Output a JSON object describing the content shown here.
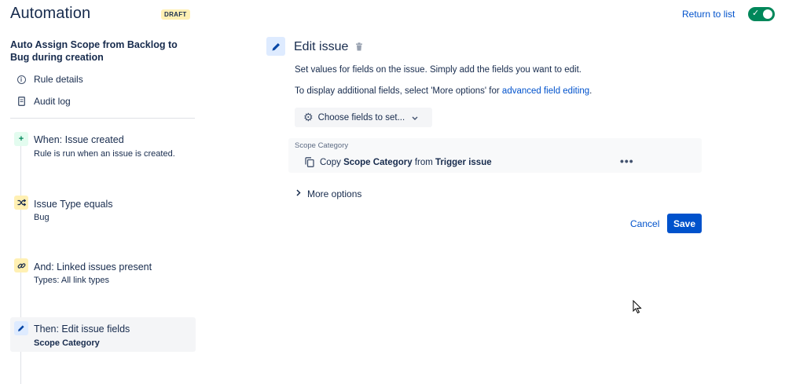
{
  "header": {
    "title": "Automation",
    "badge": "DRAFT",
    "return_link": "Return to list",
    "toggle_state": "enabled",
    "accent_color": "#00875a"
  },
  "sidebar": {
    "rule_name": "Auto Assign Scope from Backlog to Bug during creation",
    "meta": [
      {
        "label": "Rule details",
        "icon": "info-icon"
      },
      {
        "label": "Audit log",
        "icon": "document-icon"
      }
    ],
    "steps": [
      {
        "title": "When: Issue created",
        "subtitle": "Rule is run when an issue is created.",
        "icon": "plus-icon"
      },
      {
        "title": "Issue Type equals",
        "subtitle": "Bug",
        "icon": "shuffle-icon"
      },
      {
        "title": "And: Linked issues present",
        "subtitle": "Types: All link types",
        "icon": "link-icon"
      },
      {
        "title": "Then: Edit issue fields",
        "subtitle": "Scope Category",
        "icon": "pencil-icon",
        "selected": true
      }
    ]
  },
  "main": {
    "title": "Edit issue",
    "description_1": "Set values for fields on the issue. Simply add the fields you want to edit.",
    "description_2_prefix": "To display additional fields, select 'More options' for ",
    "description_2_link": "advanced field editing",
    "description_2_suffix": ".",
    "choose_fields_label": "Choose fields to set...",
    "field": {
      "label": "Scope Category",
      "copy_word": "Copy",
      "field_name": "Scope Category",
      "from_word": "from",
      "source": "Trigger issue"
    },
    "more_options_label": "More options",
    "cancel_label": "Cancel",
    "save_label": "Save",
    "brand_color": "#0052cc"
  }
}
